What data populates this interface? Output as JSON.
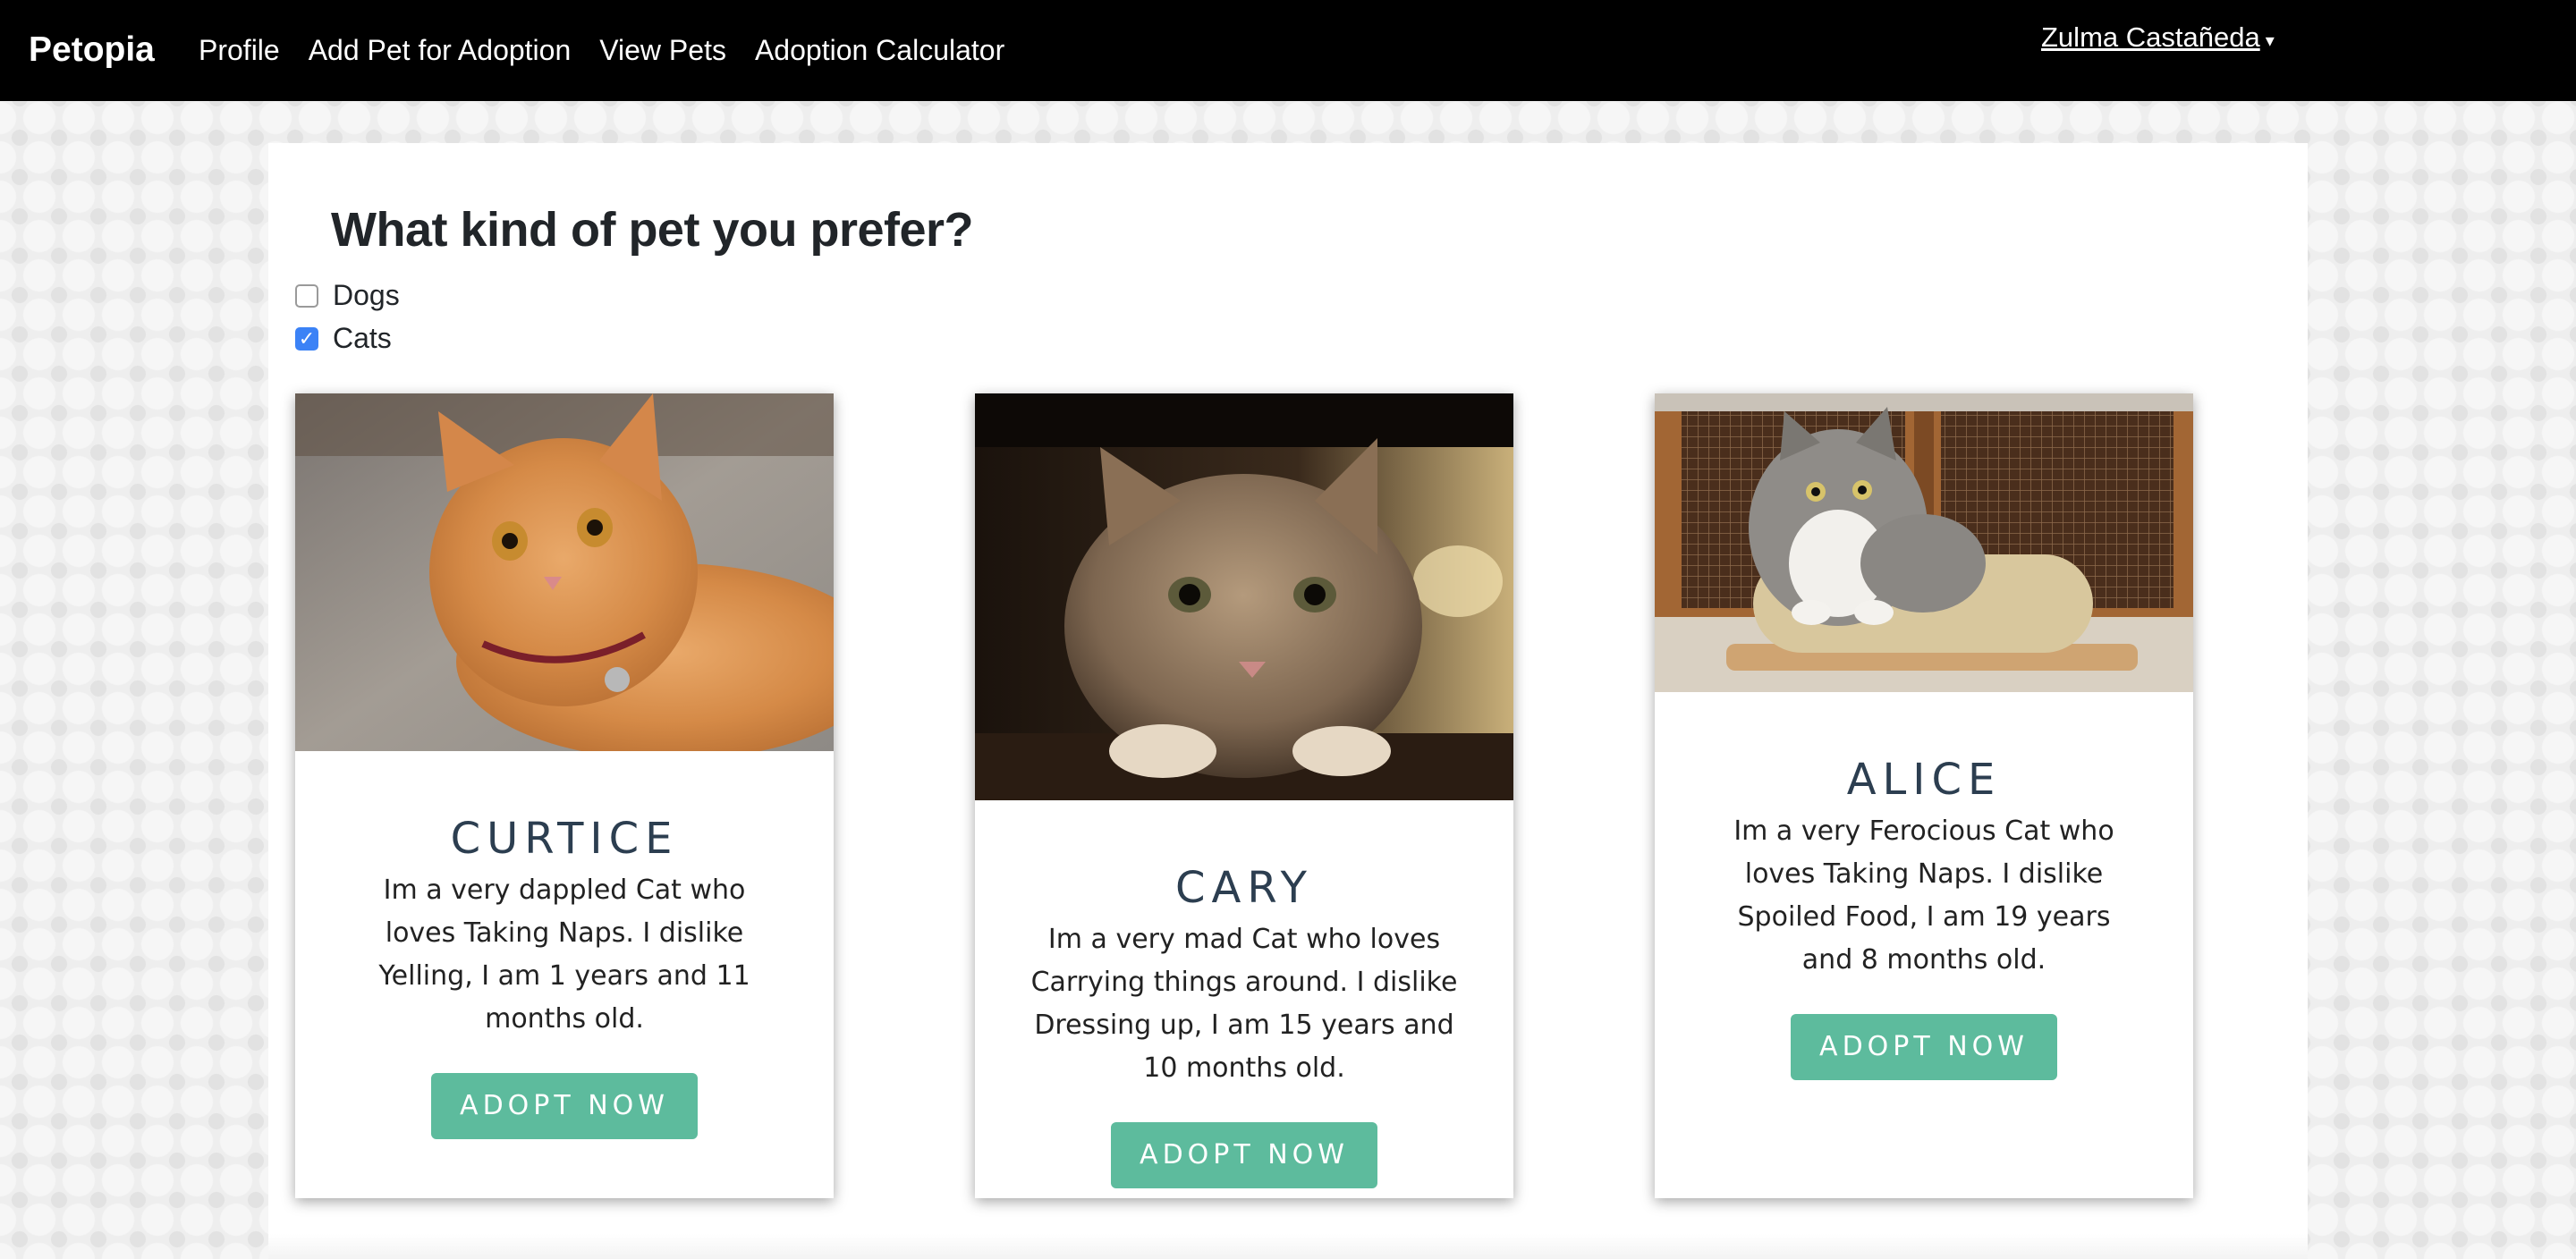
{
  "nav": {
    "brand": "Petopia",
    "links": [
      "Profile",
      "Add Pet for Adoption",
      "View Pets",
      "Adoption Calculator"
    ],
    "user": "Zulma Castañeda",
    "user_caret": "▾"
  },
  "filter": {
    "question": "What kind of pet you prefer?",
    "options": [
      {
        "label": "Dogs",
        "checked": false
      },
      {
        "label": "Cats",
        "checked": true
      }
    ],
    "check_glyph": "✓"
  },
  "pets": [
    {
      "name": "CURTICE",
      "description": "Im a very dappled Cat who loves Taking Naps. I dislike Yelling, I am 1 years and 11 months old.",
      "button": "ADOPT NOW",
      "image": "orange-tabby-cat-photo"
    },
    {
      "name": "CARY",
      "description": "Im a very mad Cat who loves Carrying things around. I dislike Dressing up, I am 15 years and 10 months old.",
      "button": "ADOPT NOW",
      "image": "tabby-cat-under-furniture-photo"
    },
    {
      "name": "ALICE",
      "description": "Im a very Ferocious Cat who loves Taking Naps. I dislike Spoiled Food, I am 19 years and 8 months old.",
      "button": "ADOPT NOW",
      "image": "grey-white-cat-on-scratcher-photo"
    }
  ],
  "colors": {
    "navbar": "#000000",
    "button": "#5dbb9d",
    "checkbox": "#3b82f6",
    "name_text": "#2c3e50"
  }
}
